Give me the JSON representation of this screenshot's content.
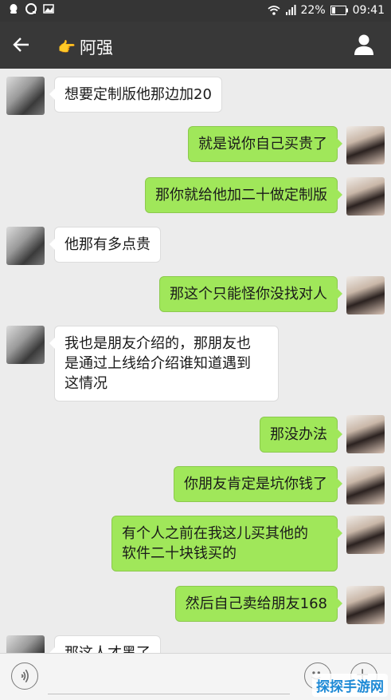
{
  "status_bar": {
    "battery": "22%",
    "time": "09:41",
    "left_icons": [
      "qq-icon",
      "chat-icon",
      "image-icon"
    ],
    "right_icons": [
      "wifi-icon",
      "signal-icon",
      "battery-icon"
    ]
  },
  "header": {
    "emoji": "👉",
    "title": "阿强"
  },
  "messages": [
    {
      "side": "left",
      "text": "想要定制版他那边加20"
    },
    {
      "side": "right",
      "text": "就是说你自己买贵了"
    },
    {
      "side": "right",
      "text": "那你就给他加二十做定制版"
    },
    {
      "side": "left",
      "text": "他那有多点贵"
    },
    {
      "side": "right",
      "text": "那这个只能怪你没找对人"
    },
    {
      "side": "left",
      "text": "我也是朋友介绍的，那朋友也\n是通过上线给介绍谁知道遇到\n这情况"
    },
    {
      "side": "right",
      "text": "那没办法"
    },
    {
      "side": "right",
      "text": "你朋友肯定是坑你钱了"
    },
    {
      "side": "right",
      "text": "有个人之前在我这儿买其他的\n软件二十块钱买的"
    },
    {
      "side": "right",
      "text": "然后自己卖给朋友168"
    },
    {
      "side": "left",
      "text": "那这人才黑了"
    }
  ],
  "input": {
    "placeholder": ""
  },
  "watermark": "探探手游网",
  "colors": {
    "sent_bubble": "#a0e75a",
    "received_bubble": "#ffffff",
    "header_bg": "#383838",
    "status_bg": "#353535"
  }
}
